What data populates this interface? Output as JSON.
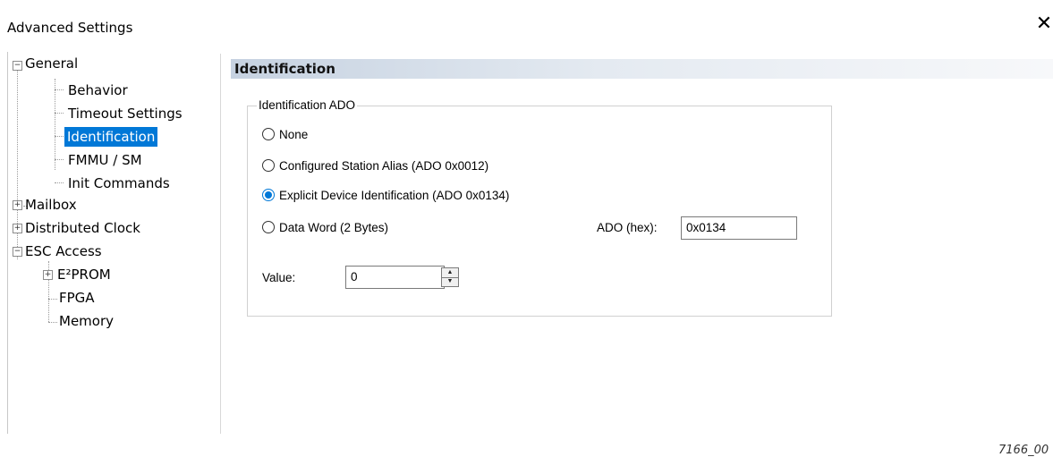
{
  "window": {
    "title": "Advanced Settings",
    "close_symbol": "✕"
  },
  "tree": {
    "general": "General",
    "behavior": "Behavior",
    "timeout_settings": "Timeout Settings",
    "identification": "Identification",
    "fmmu_sm": "FMMU / SM",
    "init_commands": "Init Commands",
    "mailbox": "Mailbox",
    "distributed_clock": "Distributed Clock",
    "esc_access": "ESC Access",
    "eeprom": "E²PROM",
    "fpga": "FPGA",
    "memory": "Memory",
    "expanded_symbol": "−",
    "collapsed_symbol": "+"
  },
  "panel": {
    "header": "Identification",
    "group_title": "Identification ADO",
    "options": {
      "none": "None",
      "configured_alias": "Configured Station Alias (ADO 0x0012)",
      "explicit_device": "Explicit Device Identification (ADO 0x0134)",
      "data_word": "Data Word (2 Bytes)"
    },
    "selected_option": "explicit_device",
    "ado_label": "ADO (hex):",
    "ado_value": "0x0134",
    "value_label": "Value:",
    "value_value": "0"
  },
  "figure_number": "7166_00",
  "colors": {
    "selection": "#0078d7",
    "header_gradient_start": "#c6d2e1"
  }
}
